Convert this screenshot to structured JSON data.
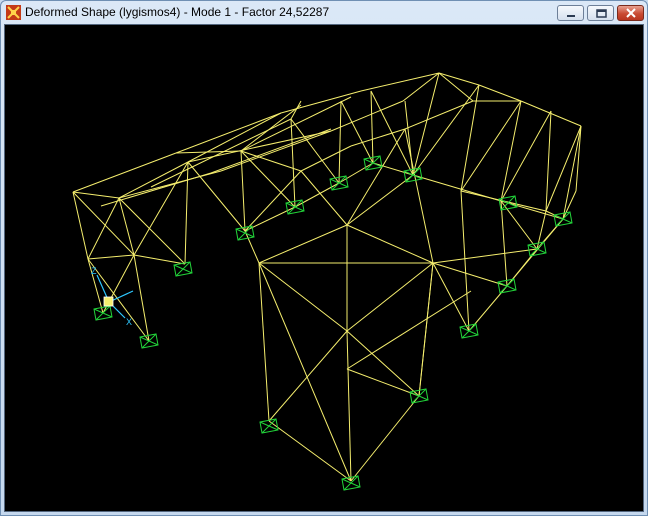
{
  "window": {
    "title": "Deformed Shape (lygismos4) - Mode 1 - Factor 24,52287",
    "icon": "sap-app-icon",
    "buttons": [
      "minimize-icon",
      "maximize-icon",
      "close-icon"
    ]
  },
  "viewport": {
    "background": "#000000",
    "frame_color": "#f5ee6e",
    "support_color": "#22d43a",
    "axis_color": "#2ec8ff",
    "axes": {
      "x_label": "X",
      "z_label": "Z"
    }
  }
}
